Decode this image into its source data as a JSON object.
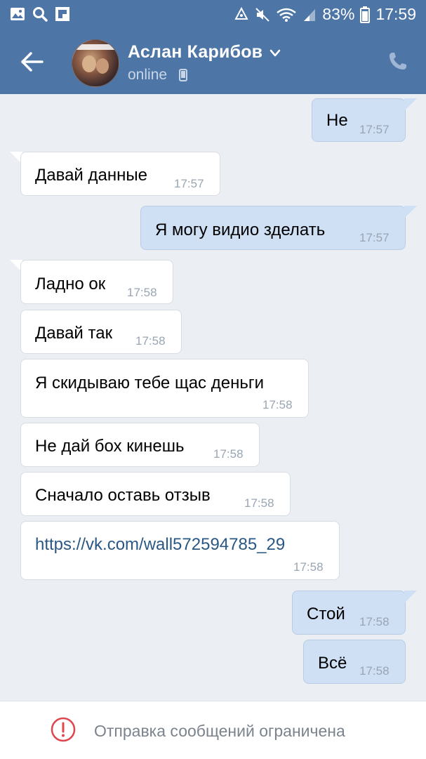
{
  "status_bar": {
    "battery": "83%",
    "time": "17:59",
    "icons": [
      "gallery-icon",
      "search-icon",
      "flipboard-icon",
      "recycle-icon",
      "mute-icon",
      "wifi-icon",
      "signal-icon",
      "battery-icon"
    ]
  },
  "header": {
    "name": "Аслан Карибов",
    "status": "online",
    "accent_color": "#4d75a6"
  },
  "messages": [
    {
      "dir": "out",
      "text": "Не",
      "time": "17:57"
    },
    {
      "dir": "in",
      "text": "Давай данные",
      "time": "17:57"
    },
    {
      "dir": "out",
      "text": "Я могу видио зделать",
      "time": "17:57"
    },
    {
      "dir": "in",
      "text": "Ладно ок",
      "time": "17:58"
    },
    {
      "dir": "in",
      "text": "Давай так",
      "time": "17:58"
    },
    {
      "dir": "in",
      "text": "Я скидываю тебе щас деньги",
      "time": "17:58"
    },
    {
      "dir": "in",
      "text": "Не дай бох кинешь",
      "time": "17:58"
    },
    {
      "dir": "in",
      "text": "Сначало оставь отзыв",
      "time": "17:58"
    },
    {
      "dir": "in",
      "text": "https://vk.com/wall572594785_29",
      "time": "17:58",
      "is_link": true
    },
    {
      "dir": "out",
      "text": "Стой",
      "time": "17:58"
    },
    {
      "dir": "out",
      "text": "Всё",
      "time": "17:58"
    }
  ],
  "footer": {
    "notice": "Отправка сообщений ограничена"
  }
}
